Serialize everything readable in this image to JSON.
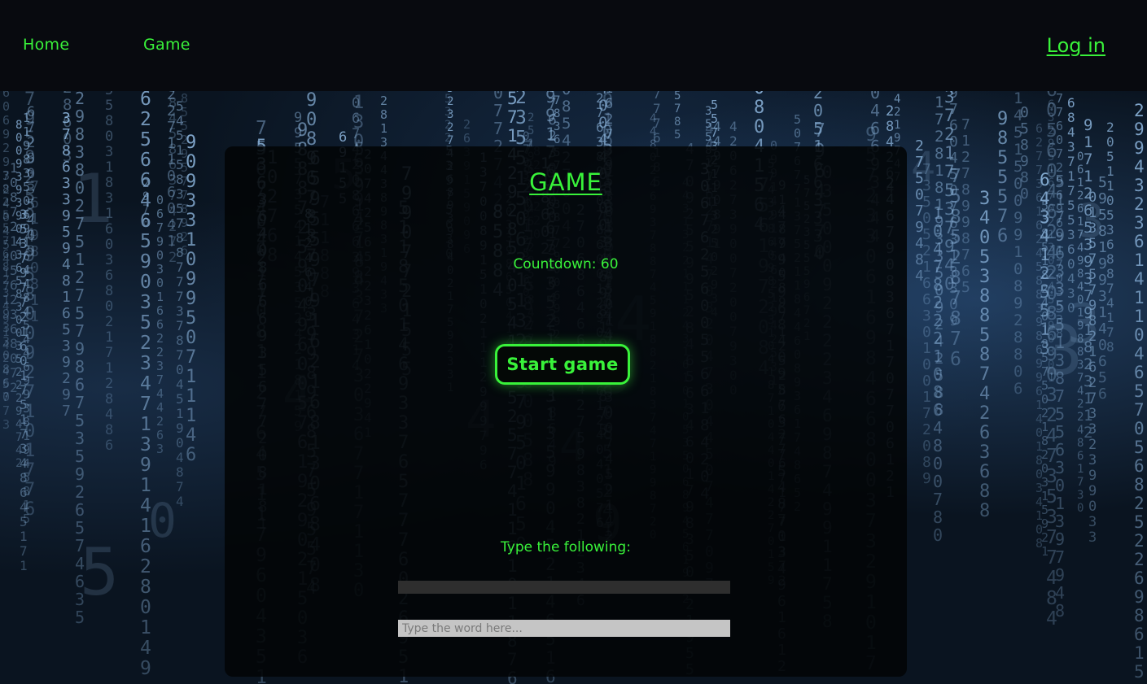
{
  "nav": {
    "home_label": "Home",
    "game_label": "Game",
    "login_label": "Log in"
  },
  "game": {
    "title": "GAME",
    "countdown_label": "Countdown: 60",
    "start_button_label": "Start game",
    "prompt_label": "Type the following:",
    "word_display": "",
    "input_placeholder": "Type the word here...",
    "input_value": ""
  },
  "colors": {
    "accent": "#39f23a",
    "panel_background": "#020406",
    "matrix_digit": "#8fb8e0"
  },
  "background": {
    "description_icon": "matrix-code-rain"
  }
}
